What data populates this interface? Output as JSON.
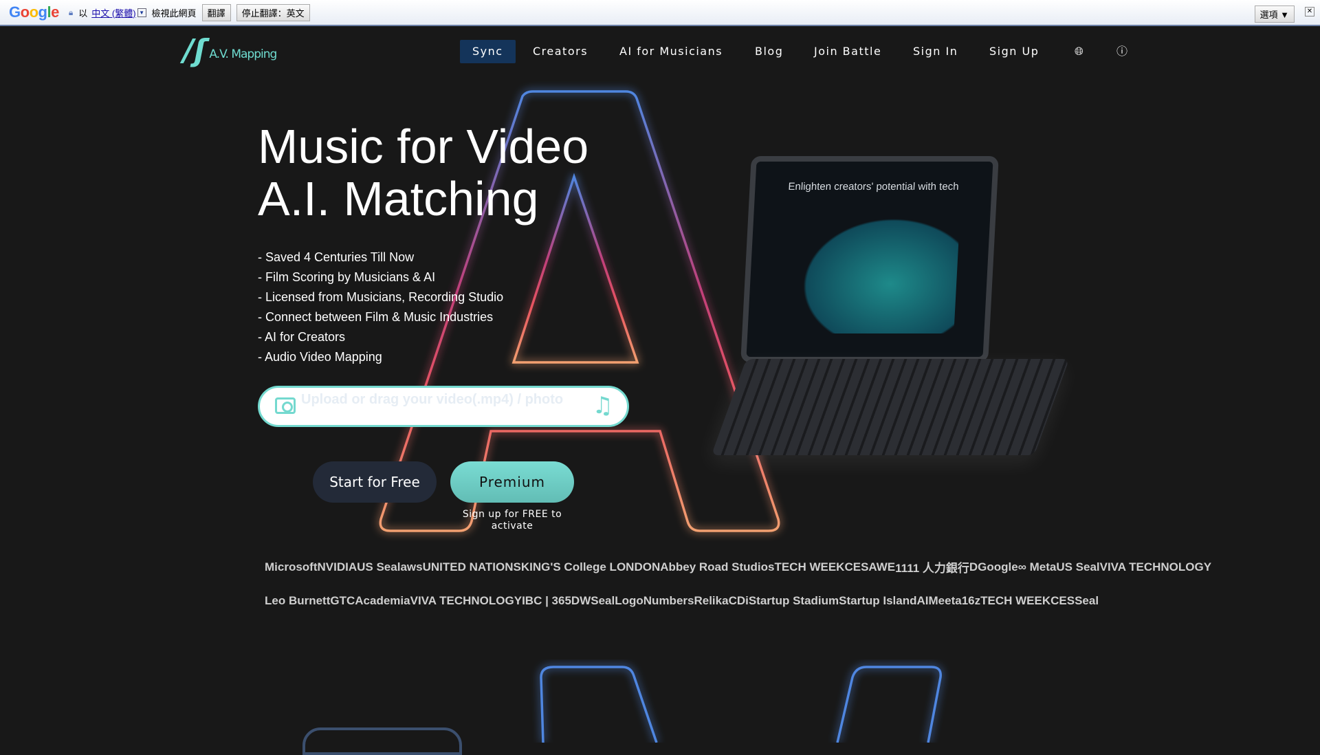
{
  "translate_bar": {
    "brand": "Google",
    "prefix": "以",
    "language": "中文 (繁體)",
    "suffix": "檢視此網頁",
    "translate_btn": "翻譯",
    "stop_btn": "停止翻譯：英文",
    "options": "選項 ▼",
    "close": "✕"
  },
  "nav": {
    "logo_text": "A.V. Mapping",
    "items": [
      {
        "label": "Sync",
        "active": true
      },
      {
        "label": "Creators"
      },
      {
        "label": "AI for Musicians"
      },
      {
        "label": "Blog"
      },
      {
        "label": "Join Battle"
      },
      {
        "label": "Sign In"
      },
      {
        "label": "Sign Up"
      }
    ],
    "globe_icon": "globe-icon",
    "help_icon": "question-circle-icon"
  },
  "hero": {
    "title_line1": "Music for Video",
    "title_line2": "A.I. Matching",
    "bullets": [
      "- Saved 4 Centuries Till Now",
      "- Film Scoring by Musicians & AI",
      "- Licensed from Musicians, Recording Studio",
      "- Connect between Film & Music Industries",
      "- AI for Creators",
      "- Audio Video Mapping"
    ],
    "upload_placeholder": "Upload or drag your video(.mp4) / photo",
    "start_btn": "Start for Free",
    "premium_btn": "Premium",
    "premium_note": "Sign up for FREE to activate",
    "tablet_caption": "Enlighten creators' potential with tech"
  },
  "colors": {
    "accent": "#74d9cf",
    "nav_active": "#14345a",
    "bg": "#181818"
  },
  "logos_row1": [
    "Microsoft",
    "NVIDIA",
    "US Seal",
    "aws",
    "UNITED NATIONS",
    "KING'S College LONDON",
    "Abbey Road Studios",
    "TECH WEEK",
    "CES",
    "AWE",
    "1111 人力銀行",
    "D",
    "Google",
    "∞ Meta",
    "US Seal",
    "VIVA TECHNOLOGY"
  ],
  "logos_row2": [
    "Leo Burnett",
    "GTC",
    "Academia",
    "VIVA TECHNOLOGY",
    "IBC | 365",
    "DW",
    "Seal",
    "Logo",
    "Numbers",
    "Relika",
    "CDi",
    "Startup Stadium",
    "Startup Island",
    "AI",
    "Meet",
    "a16z",
    "TECH WEEK",
    "CES",
    "Seal"
  ]
}
